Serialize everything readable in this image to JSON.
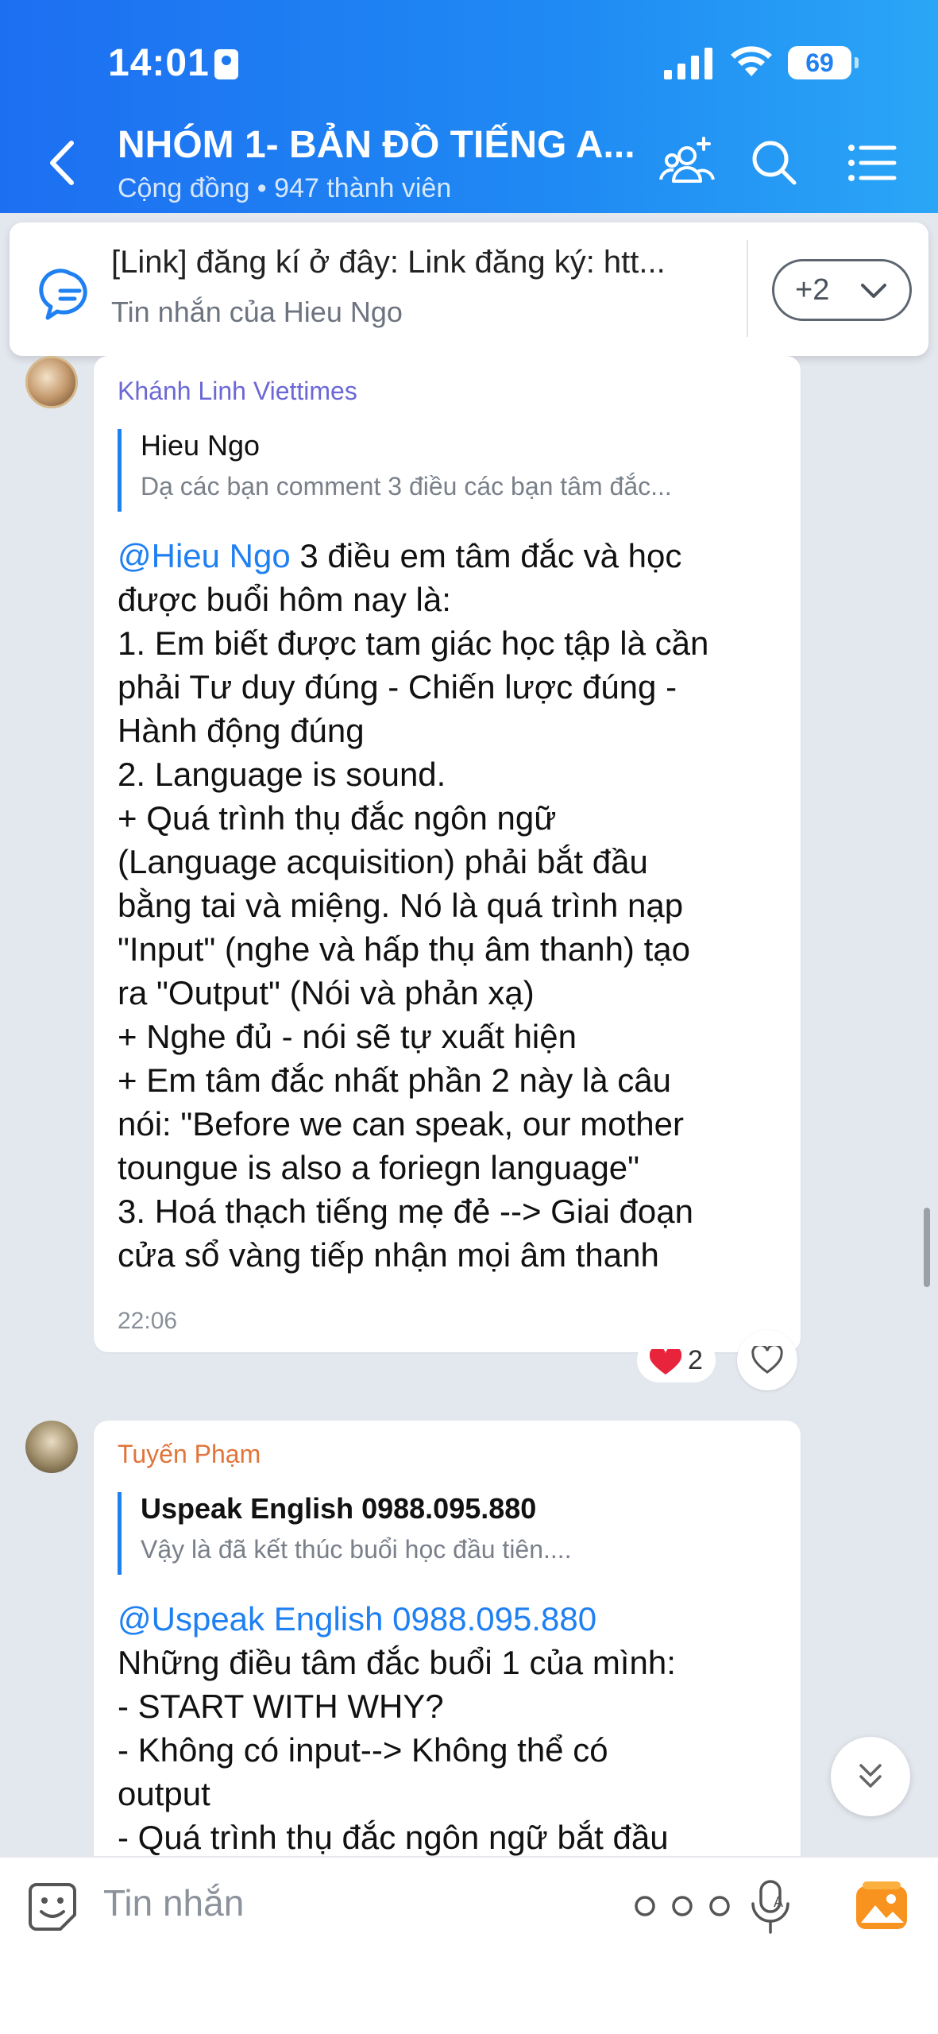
{
  "status_bar": {
    "time": "14:01",
    "battery": "69"
  },
  "header": {
    "title": "NHÓM 1- BẢN ĐỒ TIẾNG A...",
    "subtitle": "Cộng đồng • 947 thành viên"
  },
  "pinned": {
    "text": "[Link] đăng kí ở đây: Link đăng ký: htt...",
    "sub": "Tin nhắn của Hieu Ngo",
    "more_label": "+2"
  },
  "messages": [
    {
      "sender": "Khánh Linh Viettimes",
      "sender_color": "#6b68d6",
      "quote_name": "Hieu Ngo",
      "quote_text": "Dạ các bạn comment 3 điều các bạn tâm đắc...",
      "mention": "@Hieu Ngo",
      "lines": [
        " 3 điều em tâm đắc và học",
        "được buổi hôm nay là:",
        "1. Em biết được tam giác học tập là cần",
        "phải Tư duy đúng - Chiến lược đúng -",
        "Hành động đúng",
        "2. Language is sound.",
        "+ Quá trình thụ đắc ngôn ngữ",
        "(Language acquisition)  phải bắt đầu",
        "bằng tai và miệng. Nó là quá trình nạp",
        "\"Input\" (nghe và hấp thụ âm thanh) tạo",
        "ra \"Output\" (Nói và phản xạ)",
        "+ Nghe đủ - nói sẽ tự xuất hiện",
        "+ Em tâm đắc nhất phần 2 này là câu",
        "nói: \"Before we can speak, our mother",
        "toungue is also a foriegn language\"",
        "3. Hoá thạch tiếng mẹ đẻ --> Giai đoạn",
        "cửa sổ vàng tiếp nhận mọi âm thanh"
      ],
      "time": "22:06",
      "reaction_count": "2"
    },
    {
      "sender": "Tuyến Phạm",
      "sender_color": "#e0743a",
      "quote_name": "Uspeak English 0988.095.880",
      "quote_text": "Vậy là đã kết thúc buổi học đầu tiên....",
      "mention": "@Uspeak English 0988.095.880",
      "lines": [
        "Những điều tâm đắc buổi 1 của mình:",
        " - START WITH WHY?",
        " - Không có input--> Không thể có",
        "output",
        " - Quá trình thụ đắc ngôn ngữ bắt đầu"
      ]
    }
  ],
  "composer": {
    "placeholder": "Tin nhắn"
  },
  "colors": {
    "accent": "#1f80f2",
    "header_start": "#1d6ff2",
    "header_end": "#2aa6f6",
    "heart": "#e8243c"
  }
}
